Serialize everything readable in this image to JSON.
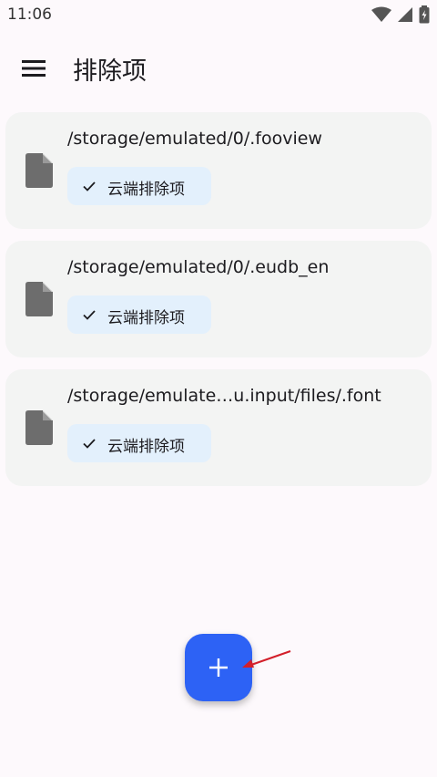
{
  "status": {
    "time": "11:06"
  },
  "app_bar": {
    "title": "排除项"
  },
  "exclusions": [
    {
      "path": "/storage/emulated/0/.fooview",
      "badge": "云端排除项"
    },
    {
      "path": "/storage/emulated/0/.eudb_en",
      "badge": "云端排除项"
    },
    {
      "path": "/storage/emulate…u.input/files/.font",
      "badge": "云端排除项"
    }
  ],
  "icons": {
    "menu": "menu-icon",
    "file": "file-icon",
    "check": "check-icon",
    "add": "add-icon",
    "wifi": "wifi-icon",
    "signal": "signal-icon",
    "battery": "battery-icon"
  },
  "colors": {
    "background": "#fdf9fc",
    "card": "#f3f4f3",
    "chip": "#e3f0fc",
    "fab": "#2d62f5",
    "annotation": "#d31f2a"
  }
}
